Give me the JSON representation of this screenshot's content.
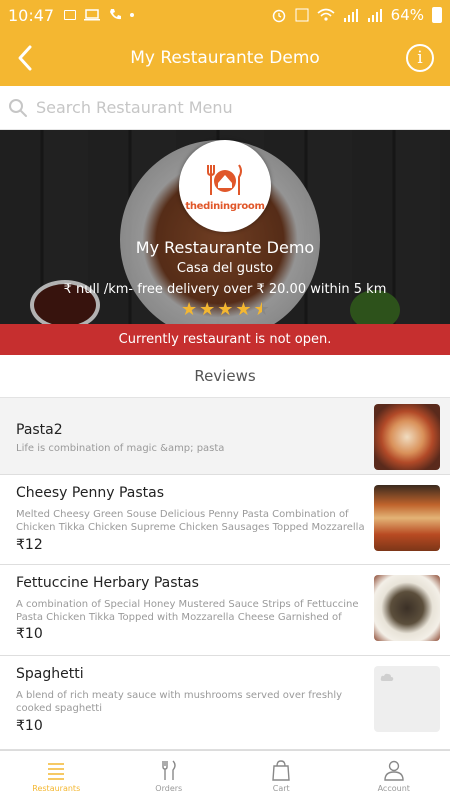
{
  "status_bar": {
    "time": "10:47",
    "battery": "64%",
    "icons": [
      "image-icon",
      "laptop-icon",
      "phone-icon",
      "dot-icon",
      "alarm-icon",
      "volte-icon",
      "wifi-icon",
      "signal-icon",
      "signal-icon",
      "battery-icon"
    ]
  },
  "app_bar": {
    "title": "My Restaurante Demo",
    "back_icon": "chevron-left-icon",
    "info_icon": "info-icon",
    "info_glyph": "i"
  },
  "search": {
    "placeholder": "Search Restaurant Menu",
    "value": ""
  },
  "restaurant": {
    "logo_text": "thediningroom",
    "name": "My Restaurante Demo",
    "tagline": "Casa del gusto",
    "delivery": "₹ null /km- free delivery over ₹ 20.00 within 5 km",
    "rating": 4.5,
    "rating_max": 5
  },
  "notice": {
    "text": "Currently restaurant is not open."
  },
  "reviews": {
    "label": "Reviews"
  },
  "menu_items": [
    {
      "name": "Pasta2",
      "description": "Life is combination of magic &amp; pasta",
      "price": ""
    },
    {
      "name": "Cheesy Penny Pastas",
      "description": "Melted Cheesy Green Souse Delicious Penny Pasta Combination of Chicken Tikka Chicken Supreme Chicken Sausages  Topped Mozzarella",
      "price": "₹12"
    },
    {
      "name": "Fettuccine Herbary Pastas",
      "description": "A combination of Special Honey Mustered Sauce Strips of Fettuccine Pasta Chicken Tikka Topped with Mozzarella Cheese Garnished of",
      "price": "₹10"
    },
    {
      "name": "Spaghetti",
      "description": "A blend of rich meaty sauce with mushrooms served over freshly cooked spaghetti",
      "price": "₹10"
    }
  ],
  "bottom_nav": {
    "items": [
      {
        "label": "Restaurants",
        "icon": "list-icon",
        "active": true
      },
      {
        "label": "Orders",
        "icon": "fork-knife-icon",
        "active": false
      },
      {
        "label": "Cart",
        "icon": "shopping-bag-icon",
        "active": false
      },
      {
        "label": "Account",
        "icon": "user-icon",
        "active": false
      }
    ]
  },
  "colors": {
    "primary": "#f4b731",
    "notice_bg": "#c62f2f",
    "logo_accent": "#e0572a"
  }
}
